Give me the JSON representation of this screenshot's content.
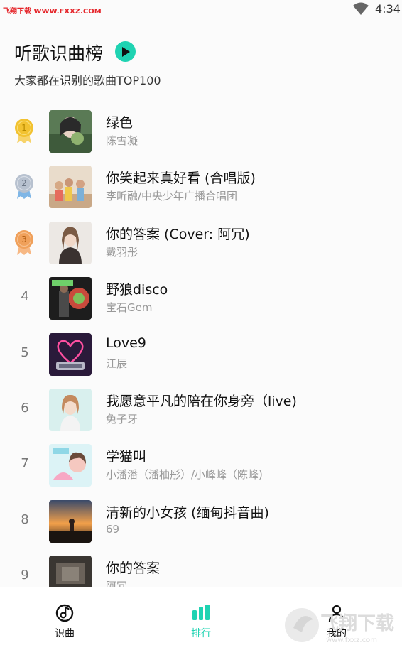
{
  "status_bar": {
    "watermark": "飞翔下载 WWW.FXXZ.COM",
    "time": "4:34"
  },
  "header": {
    "title": "听歌识曲榜",
    "subtitle": "大家都在识别的歌曲TOP100"
  },
  "songs": [
    {
      "rank": "1",
      "title": "绿色",
      "artist": "陈雪凝",
      "medal": "gold"
    },
    {
      "rank": "2",
      "title": "你笑起来真好看 (合唱版)",
      "artist": "李昕融/中央少年广播合唱团",
      "medal": "silver"
    },
    {
      "rank": "3",
      "title": "你的答案 (Cover: 阿冗)",
      "artist": "戴羽彤",
      "medal": "bronze"
    },
    {
      "rank": "4",
      "title": "野狼disco",
      "artist": "宝石Gem"
    },
    {
      "rank": "5",
      "title": "Love9",
      "artist": "江辰"
    },
    {
      "rank": "6",
      "title": "我愿意平凡的陪在你身旁（live)",
      "artist": "兔子牙"
    },
    {
      "rank": "7",
      "title": "学猫叫",
      "artist": "小潘潘（潘柚彤）/小峰峰（陈峰)"
    },
    {
      "rank": "8",
      "title": "清新的小女孩 (缅甸抖音曲)",
      "artist": "69"
    },
    {
      "rank": "9",
      "title": "你的答案",
      "artist": "阿冗"
    }
  ],
  "nav": {
    "items": [
      {
        "label": "识曲",
        "icon": "music-note-icon",
        "active": false
      },
      {
        "label": "排行",
        "icon": "bar-chart-icon",
        "active": true
      },
      {
        "label": "我的",
        "icon": "person-icon",
        "active": false
      }
    ]
  },
  "watermark_logo": "飞翔下载",
  "watermark_logo_url": "www.fxxz.com",
  "colors": {
    "accent": "#1fd3b2",
    "gold": "#f2c230",
    "silver": "#a9b4c2",
    "bronze": "#f0a05a"
  }
}
